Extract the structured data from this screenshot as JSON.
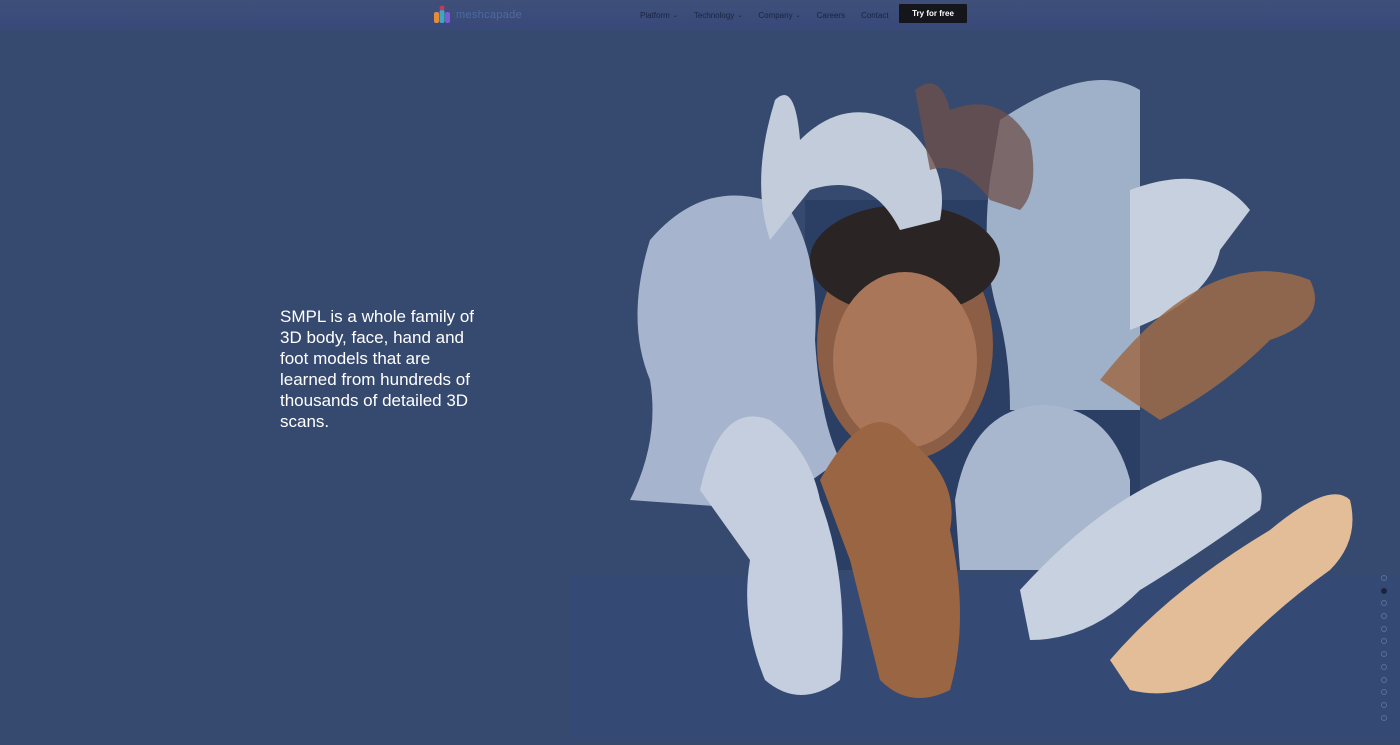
{
  "header": {
    "logo_text": "meshcapade",
    "menu": [
      {
        "label": "Platform",
        "has_dropdown": true
      },
      {
        "label": "Technology",
        "has_dropdown": true
      },
      {
        "label": "Company",
        "has_dropdown": true
      },
      {
        "label": "Careers",
        "has_dropdown": false
      },
      {
        "label": "Contact",
        "has_dropdown": false
      }
    ],
    "cta_label": "Try for free"
  },
  "hero": {
    "headline": "SMPL is a whole family of 3D body, face, hand and foot models that are learned from hundreds of thousands of detailed 3D scans."
  },
  "pagination": {
    "count": 12,
    "active_index": 1
  },
  "colors": {
    "background": "#36496f",
    "cta": "#15151c",
    "text": "#ffffff"
  }
}
